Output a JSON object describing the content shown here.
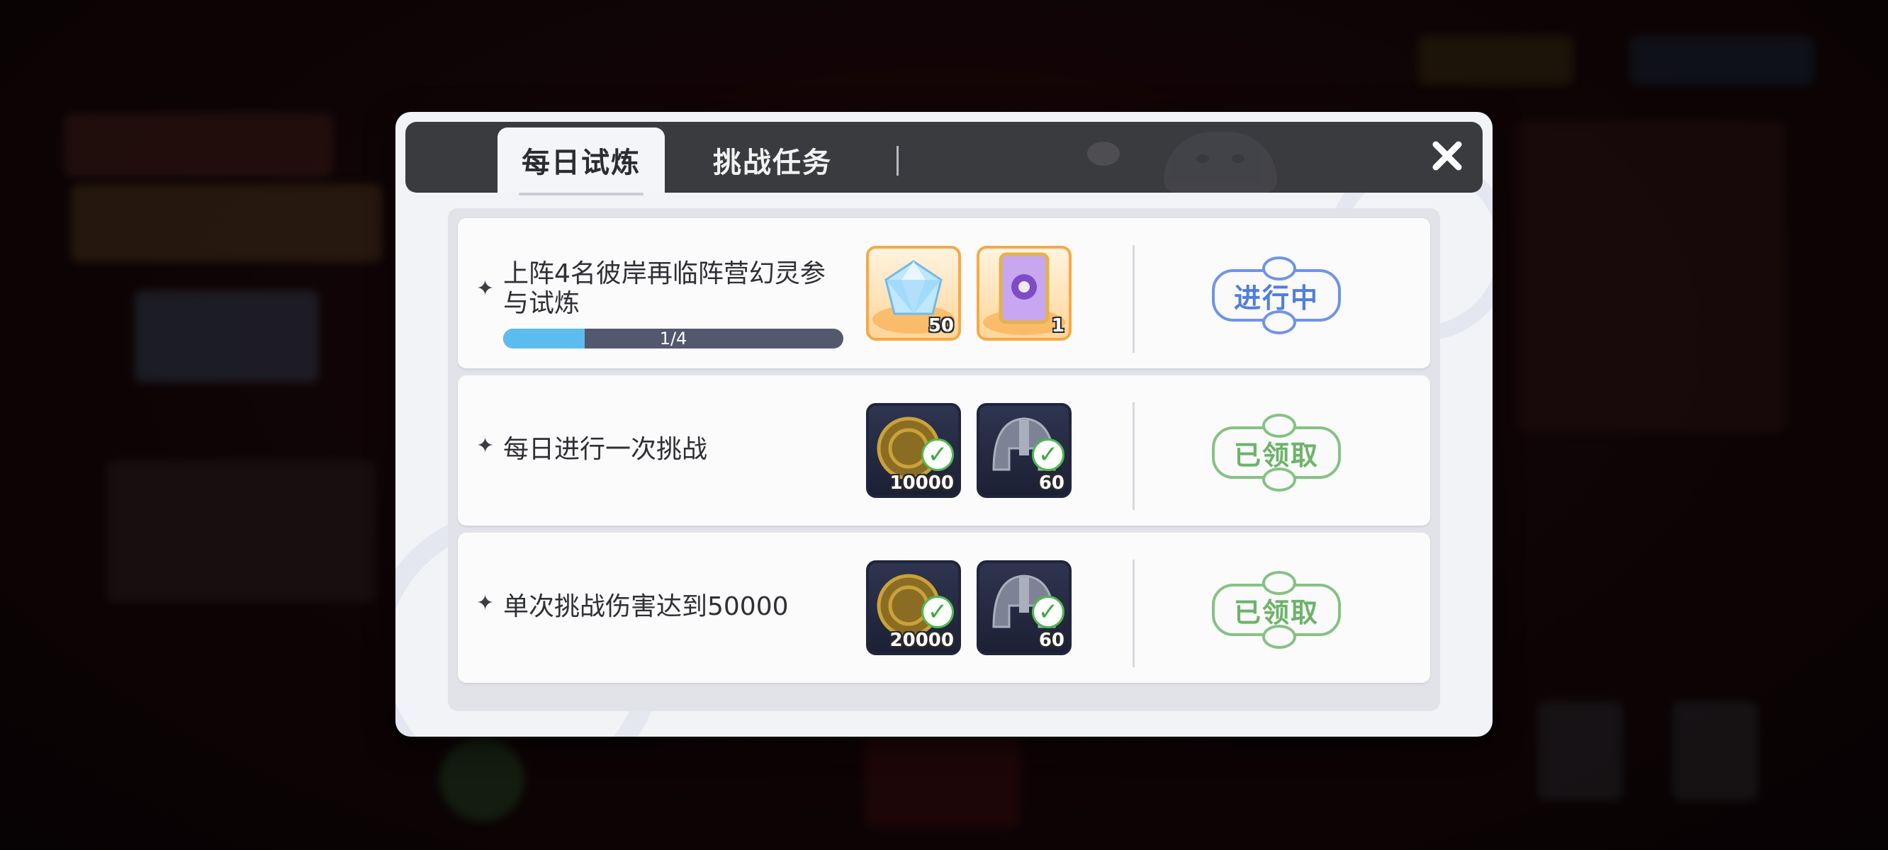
{
  "dialog": {
    "tabs": [
      {
        "label": "每日试炼",
        "active": true
      },
      {
        "label": "挑战任务",
        "active": false
      }
    ],
    "close_icon": "close-icon"
  },
  "tasks": [
    {
      "title": "上阵4名彼岸再临阵营幻灵参\n与试炼",
      "progress_text": "1/4",
      "progress": 0.25,
      "rewards": [
        {
          "icon": "diamond-icon",
          "count": "50",
          "claimed": false
        },
        {
          "icon": "spirit-card-icon",
          "count": "1",
          "claimed": false
        }
      ],
      "status": "进行中"
    },
    {
      "title": "每日进行一次挑战",
      "rewards": [
        {
          "icon": "gold-coin-icon",
          "count": "10000",
          "claimed": true
        },
        {
          "icon": "helmet-icon",
          "count": "60",
          "claimed": true
        }
      ],
      "status": "已领取"
    },
    {
      "title": "单次挑战伤害达到50000",
      "rewards": [
        {
          "icon": "gold-coin-icon",
          "count": "20000",
          "claimed": true
        },
        {
          "icon": "helmet-icon",
          "count": "60",
          "claimed": true
        }
      ],
      "status": "已领取"
    }
  ],
  "colors": {
    "in_progress": "#4f7ee0",
    "claimed": "#6cb36a",
    "progress_fill": "#5cbcf0",
    "header": "#3a3b3f"
  }
}
